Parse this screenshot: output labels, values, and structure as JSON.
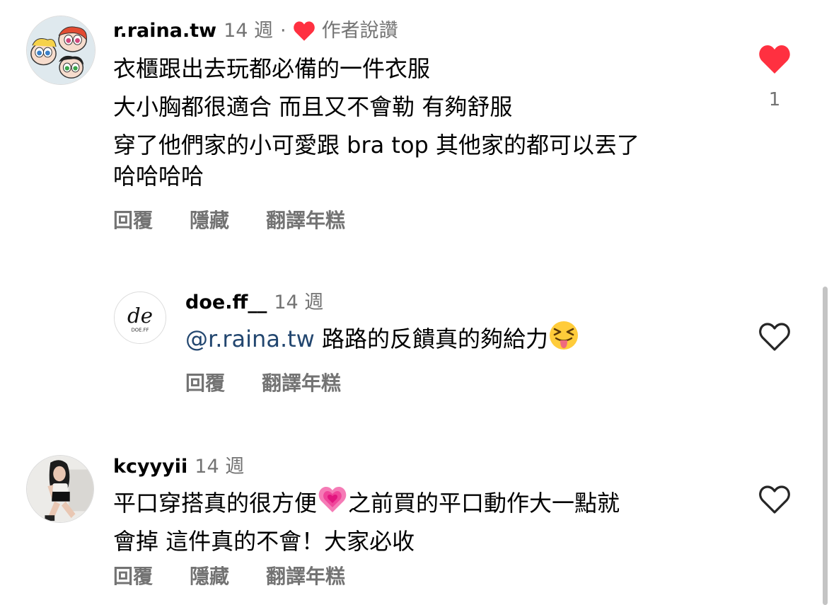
{
  "comments": [
    {
      "username": "r.raina.tw",
      "time": "14 週",
      "separator": "·",
      "author_like_label": "作者說讚",
      "lines": [
        "衣櫃跟出去玩都必備的一件衣服",
        "大小胸都很適合 而且又不會勒 有夠舒服",
        "穿了他們家的小可愛跟 bra top 其他家的都可以丟了",
        "哈哈哈哈"
      ],
      "actions": {
        "reply": "回覆",
        "hide": "隱藏",
        "translate": "翻譯年糕"
      },
      "like_count": "1",
      "liked": true
    },
    {
      "username": "doe.ff__",
      "time": "14 週",
      "mention": "@r.raina.tw",
      "text": " 路路的反饋真的夠給力",
      "avatar_logo": "de",
      "avatar_caption": "DOE.FF",
      "actions": {
        "reply": "回覆",
        "translate": "翻譯年糕"
      },
      "liked": false
    },
    {
      "username": "kcyyyii",
      "time": "14 週",
      "line1_a": "平口穿搭真的很方便",
      "line1_b": "之前買的平口動作大一點就",
      "line2": "會掉 這件真的不會！大家必收",
      "actions": {
        "reply": "回覆",
        "hide": "隱藏",
        "translate": "翻譯年糕"
      },
      "liked": false
    }
  ],
  "icons": {
    "like_filled": "heart-filled-icon",
    "like_outline": "heart-outline-icon",
    "emoji_tongue": "squinting-face-with-tongue",
    "emoji_heart": "growing-heart"
  },
  "colors": {
    "like_red": "#ff3040",
    "secondary": "#737373",
    "mention": "#22466f"
  }
}
